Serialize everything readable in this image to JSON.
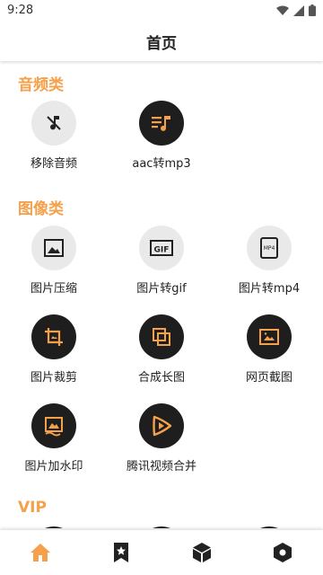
{
  "status": {
    "time": "9:28"
  },
  "header": {
    "title": "首页"
  },
  "sections": {
    "audio": {
      "title": "音频类",
      "tools": [
        {
          "label": "移除音频",
          "icon": "music-off-icon"
        },
        {
          "label": "aac转mp3",
          "icon": "music-list-icon"
        }
      ]
    },
    "image": {
      "title": "图像类",
      "tools": [
        {
          "label": "图片压缩",
          "icon": "image-icon"
        },
        {
          "label": "图片转gif",
          "icon": "gif-icon",
          "icon_text": "GIF"
        },
        {
          "label": "图片转mp4",
          "icon": "mp4-file-icon",
          "icon_text": "MP4"
        },
        {
          "label": "图片裁剪",
          "icon": "crop-icon"
        },
        {
          "label": "合成长图",
          "icon": "layers-icon"
        },
        {
          "label": "网页截图",
          "icon": "screenshot-icon"
        },
        {
          "label": "图片加水印",
          "icon": "watermark-icon"
        },
        {
          "label": "腾讯视频合并",
          "icon": "tencent-video-icon"
        }
      ]
    },
    "vip": {
      "title": "VIP"
    }
  },
  "bottom_nav": [
    {
      "icon": "home-icon",
      "active": true
    },
    {
      "icon": "bookmark-star-icon",
      "active": false
    },
    {
      "icon": "box-icon",
      "active": false
    },
    {
      "icon": "settings-hex-icon",
      "active": false
    }
  ],
  "colors": {
    "accent": "#f5a04a",
    "dark_circle": "#1e1e1e",
    "light_circle": "#e9e9e9"
  }
}
